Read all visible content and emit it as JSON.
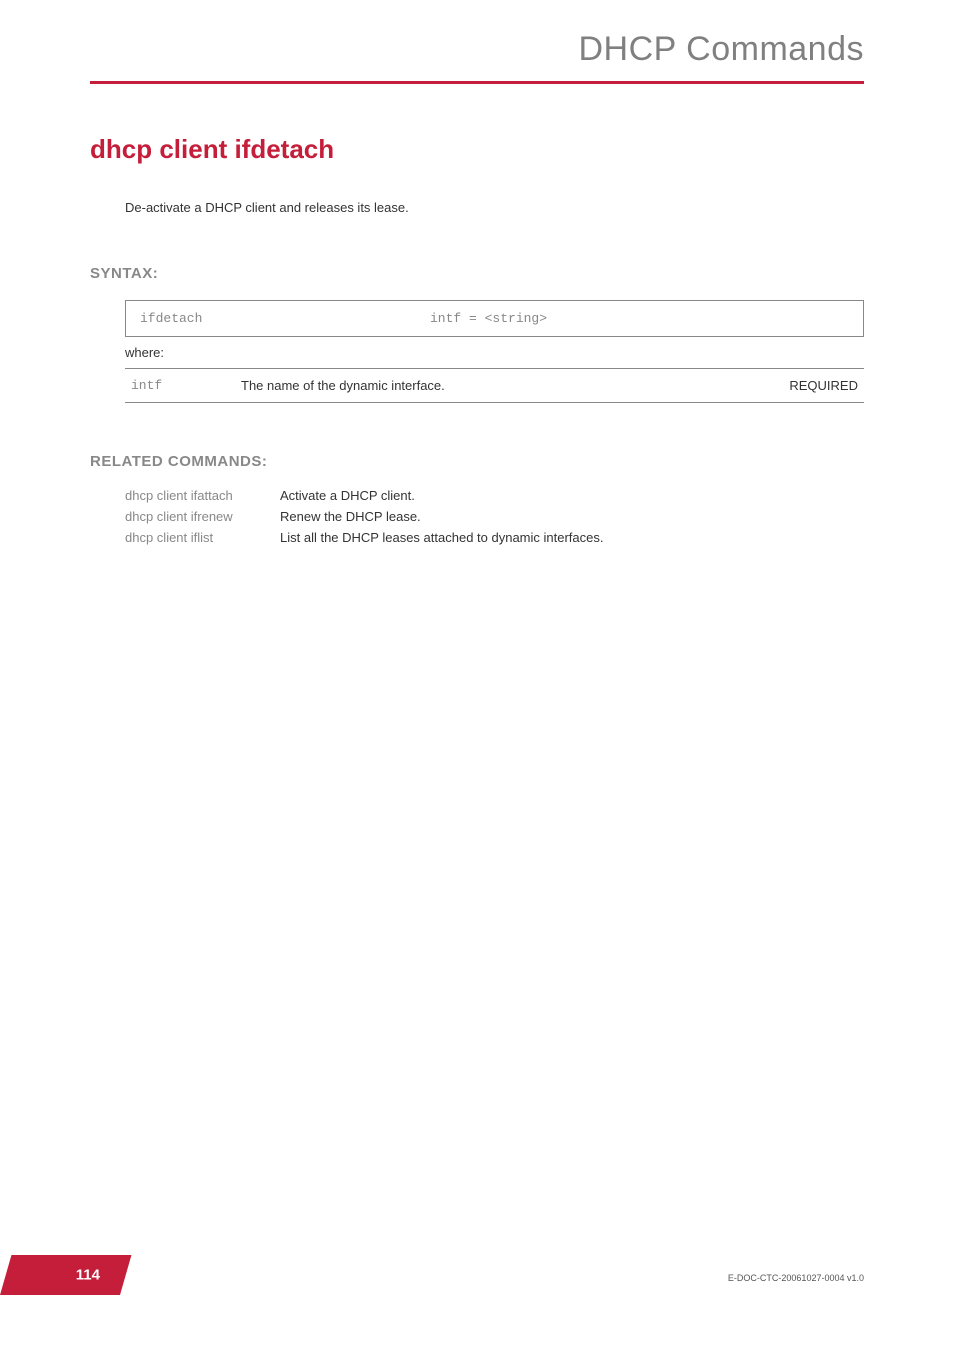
{
  "header": {
    "title": "DHCP Commands"
  },
  "command": {
    "title": "dhcp client ifdetach",
    "description": "De-activate a DHCP client and releases its lease."
  },
  "syntax": {
    "heading": "SYNTAX:",
    "command": "ifdetach",
    "params": "intf = <string>",
    "where_label": "where:",
    "param_rows": [
      {
        "name": "intf",
        "description": "The name of the dynamic interface.",
        "required": "REQUIRED"
      }
    ]
  },
  "related": {
    "heading": "RELATED COMMANDS:",
    "items": [
      {
        "command": "dhcp client ifattach",
        "description": "Activate a DHCP client."
      },
      {
        "command": "dhcp client ifrenew",
        "description": "Renew the DHCP lease."
      },
      {
        "command": "dhcp client iflist",
        "description": "List all the DHCP leases attached to dynamic interfaces."
      }
    ]
  },
  "footer": {
    "page_number": "114",
    "doc_id": "E-DOC-CTC-20061027-0004 v1.0"
  }
}
